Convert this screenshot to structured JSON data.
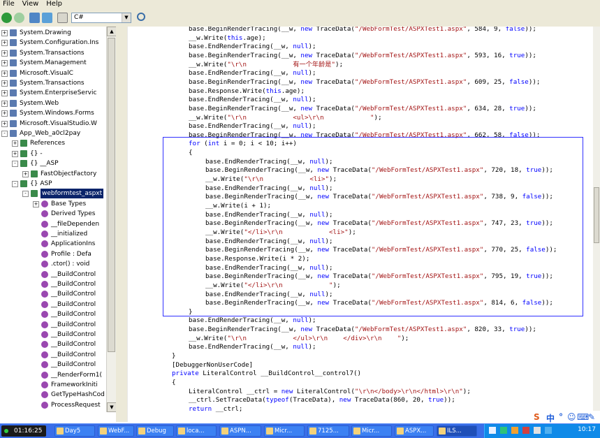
{
  "menu": [
    "File",
    "View",
    "Help"
  ],
  "toolbar": {
    "language": "C#"
  },
  "tree": {
    "items": [
      {
        "label": "System.Drawing",
        "level": 0,
        "exp": "+"
      },
      {
        "label": "System.Configuration.Ins",
        "level": 0,
        "exp": "+"
      },
      {
        "label": "System.Transactions",
        "level": 0,
        "exp": "+"
      },
      {
        "label": "System.Management",
        "level": 0,
        "exp": "+"
      },
      {
        "label": "Microsoft.VisualC",
        "level": 0,
        "exp": "+"
      },
      {
        "label": "System.Transactions",
        "level": 0,
        "exp": "+"
      },
      {
        "label": "System.EnterpriseServic",
        "level": 0,
        "exp": "+"
      },
      {
        "label": "System.Web",
        "level": 0,
        "exp": "+"
      },
      {
        "label": "System.Windows.Forms",
        "level": 0,
        "exp": "+"
      },
      {
        "label": "Microsoft.VisualStudio.W",
        "level": 0,
        "exp": "+"
      },
      {
        "label": "App_Web_a0cl2pay",
        "level": 0,
        "exp": "-"
      },
      {
        "label": "References",
        "level": 1,
        "exp": "+"
      },
      {
        "label": "{} -",
        "level": 1,
        "exp": "+"
      },
      {
        "label": "{} __ASP",
        "level": 1,
        "exp": "-"
      },
      {
        "label": "FastObjectFactory",
        "level": 2,
        "exp": "+"
      },
      {
        "label": "{} ASP",
        "level": 1,
        "exp": "-"
      },
      {
        "label": "webformtest_aspxt",
        "level": 2,
        "exp": "-",
        "selected": true
      },
      {
        "label": "Base Types",
        "level": 3,
        "exp": "+"
      },
      {
        "label": "Derived Types",
        "level": 3,
        "exp": ""
      },
      {
        "label": "__fileDependen",
        "level": 3,
        "exp": ""
      },
      {
        "label": "__initialized",
        "level": 3,
        "exp": ""
      },
      {
        "label": "ApplicationIns",
        "level": 3,
        "exp": ""
      },
      {
        "label": "Profile : Defa",
        "level": 3,
        "exp": ""
      },
      {
        "label": ".ctor() : void",
        "level": 3,
        "exp": ""
      },
      {
        "label": "__BuildControl",
        "level": 3,
        "exp": ""
      },
      {
        "label": "__BuildControl",
        "level": 3,
        "exp": ""
      },
      {
        "label": "__BuildControl",
        "level": 3,
        "exp": ""
      },
      {
        "label": "__BuildControl",
        "level": 3,
        "exp": ""
      },
      {
        "label": "__BuildControl",
        "level": 3,
        "exp": ""
      },
      {
        "label": "__BuildControl",
        "level": 3,
        "exp": ""
      },
      {
        "label": "__BuildControl",
        "level": 3,
        "exp": ""
      },
      {
        "label": "__BuildControl",
        "level": 3,
        "exp": ""
      },
      {
        "label": "__BuildControl",
        "level": 3,
        "exp": ""
      },
      {
        "label": "__BuildControl",
        "level": 3,
        "exp": ""
      },
      {
        "label": "__RenderForm1(",
        "level": 3,
        "exp": ""
      },
      {
        "label": "FrameworkIniti",
        "level": 3,
        "exp": ""
      },
      {
        "label": "GetTypeHashCod",
        "level": 3,
        "exp": ""
      },
      {
        "label": "ProcessRequest",
        "level": 3,
        "exp": ""
      }
    ]
  },
  "code": {
    "lines": [
      {
        "indent": 2,
        "parts": [
          [
            "base.BeginRenderTracing(__w, ",
            ""
          ],
          [
            "new",
            "kw"
          ],
          [
            " TraceData(",
            ""
          ],
          [
            "\"/WebFormTest/ASPXTest1.aspx\"",
            "str"
          ],
          [
            ", 584, 9, ",
            ""
          ],
          [
            "false",
            "kw"
          ],
          [
            "));",
            ""
          ]
        ]
      },
      {
        "indent": 2,
        "parts": [
          [
            "__w.Write(",
            ""
          ],
          [
            "this",
            "kw"
          ],
          [
            ".age);",
            ""
          ]
        ]
      },
      {
        "indent": 2,
        "parts": [
          [
            "base.EndRenderTracing(__w, ",
            ""
          ],
          [
            "null",
            "kw"
          ],
          [
            ");",
            ""
          ]
        ]
      },
      {
        "indent": 2,
        "parts": [
          [
            "base.BeginRenderTracing(__w, ",
            ""
          ],
          [
            "new",
            "kw"
          ],
          [
            " TraceData(",
            ""
          ],
          [
            "\"/WebFormTest/ASPXTest1.aspx\"",
            "str"
          ],
          [
            ", 593, 16, ",
            ""
          ],
          [
            "true",
            "kw"
          ],
          [
            "));",
            ""
          ]
        ]
      },
      {
        "indent": 2,
        "parts": [
          [
            "__w.Write(",
            ""
          ],
          [
            "\"\\r\\n            有一个年龄是\"",
            "str"
          ],
          [
            ");",
            ""
          ]
        ]
      },
      {
        "indent": 2,
        "parts": [
          [
            "base.EndRenderTracing(__w, ",
            ""
          ],
          [
            "null",
            "kw"
          ],
          [
            ");",
            ""
          ]
        ]
      },
      {
        "indent": 2,
        "parts": [
          [
            "base.BeginRenderTracing(__w, ",
            ""
          ],
          [
            "new",
            "kw"
          ],
          [
            " TraceData(",
            ""
          ],
          [
            "\"/WebFormTest/ASPXTest1.aspx\"",
            "str"
          ],
          [
            ", 609, 25, ",
            ""
          ],
          [
            "false",
            "kw"
          ],
          [
            "));",
            ""
          ]
        ]
      },
      {
        "indent": 2,
        "parts": [
          [
            "base.Response.Write(",
            ""
          ],
          [
            "this",
            "kw"
          ],
          [
            ".age);",
            ""
          ]
        ]
      },
      {
        "indent": 2,
        "parts": [
          [
            "base.EndRenderTracing(__w, ",
            ""
          ],
          [
            "null",
            "kw"
          ],
          [
            ");",
            ""
          ]
        ]
      },
      {
        "indent": 2,
        "parts": [
          [
            "base.BeginRenderTracing(__w, ",
            ""
          ],
          [
            "new",
            "kw"
          ],
          [
            " TraceData(",
            ""
          ],
          [
            "\"/WebFormTest/ASPXTest1.aspx\"",
            "str"
          ],
          [
            ", 634, 28, ",
            ""
          ],
          [
            "true",
            "kw"
          ],
          [
            "));",
            ""
          ]
        ]
      },
      {
        "indent": 2,
        "parts": [
          [
            "__w.Write(",
            ""
          ],
          [
            "\"\\r\\n            <ul>\\r\\n            \"",
            "str"
          ],
          [
            ");",
            ""
          ]
        ]
      },
      {
        "indent": 2,
        "parts": [
          [
            "base.EndRenderTracing(__w, ",
            ""
          ],
          [
            "null",
            "kw"
          ],
          [
            ");",
            ""
          ]
        ]
      },
      {
        "indent": 2,
        "parts": [
          [
            "base.BeginRenderTracing(__w, ",
            ""
          ],
          [
            "new",
            "kw"
          ],
          [
            " TraceData(",
            ""
          ],
          [
            "\"/WebFormTest/ASPXTest1.aspx\"",
            "str"
          ],
          [
            ", 662, 58, ",
            ""
          ],
          [
            "false",
            "kw"
          ],
          [
            "));",
            ""
          ]
        ]
      },
      {
        "indent": 2,
        "parts": [
          [
            "for",
            "kw"
          ],
          [
            " (",
            ""
          ],
          [
            "int",
            "kw"
          ],
          [
            " i = 0; i < 10; i++)",
            ""
          ]
        ]
      },
      {
        "indent": 2,
        "parts": [
          [
            "{",
            ""
          ]
        ]
      },
      {
        "indent": 3,
        "parts": [
          [
            "base.EndRenderTracing(__w, ",
            ""
          ],
          [
            "null",
            "kw"
          ],
          [
            ");",
            ""
          ]
        ]
      },
      {
        "indent": 3,
        "parts": [
          [
            "base.BeginRenderTracing(__w, ",
            ""
          ],
          [
            "new",
            "kw"
          ],
          [
            " TraceData(",
            ""
          ],
          [
            "\"/WebFormTest/ASPXTest1.aspx\"",
            "str"
          ],
          [
            ", 720, 18, ",
            ""
          ],
          [
            "true",
            "kw"
          ],
          [
            "));",
            ""
          ]
        ]
      },
      {
        "indent": 3,
        "parts": [
          [
            "__w.Write(",
            ""
          ],
          [
            "\"\\r\\n            <li>\"",
            "str"
          ],
          [
            ");",
            ""
          ]
        ]
      },
      {
        "indent": 3,
        "parts": [
          [
            "base.EndRenderTracing(__w, ",
            ""
          ],
          [
            "null",
            "kw"
          ],
          [
            ");",
            ""
          ]
        ]
      },
      {
        "indent": 3,
        "parts": [
          [
            "base.BeginRenderTracing(__w, ",
            ""
          ],
          [
            "new",
            "kw"
          ],
          [
            " TraceData(",
            ""
          ],
          [
            "\"/WebFormTest/ASPXTest1.aspx\"",
            "str"
          ],
          [
            ", 738, 9, ",
            ""
          ],
          [
            "false",
            "kw"
          ],
          [
            "));",
            ""
          ]
        ]
      },
      {
        "indent": 3,
        "parts": [
          [
            "__w.Write(i + 1);",
            ""
          ]
        ]
      },
      {
        "indent": 3,
        "parts": [
          [
            "base.EndRenderTracing(__w, ",
            ""
          ],
          [
            "null",
            "kw"
          ],
          [
            ");",
            ""
          ]
        ]
      },
      {
        "indent": 3,
        "parts": [
          [
            "base.BeginRenderTracing(__w, ",
            ""
          ],
          [
            "new",
            "kw"
          ],
          [
            " TraceData(",
            ""
          ],
          [
            "\"/WebFormTest/ASPXTest1.aspx\"",
            "str"
          ],
          [
            ", 747, 23, ",
            ""
          ],
          [
            "true",
            "kw"
          ],
          [
            "));",
            ""
          ]
        ]
      },
      {
        "indent": 3,
        "parts": [
          [
            "__w.Write(",
            ""
          ],
          [
            "\"</li>\\r\\n            <li>\"",
            "str"
          ],
          [
            ");",
            ""
          ]
        ]
      },
      {
        "indent": 3,
        "parts": [
          [
            "base.EndRenderTracing(__w, ",
            ""
          ],
          [
            "null",
            "kw"
          ],
          [
            ");",
            ""
          ]
        ]
      },
      {
        "indent": 3,
        "parts": [
          [
            "base.BeginRenderTracing(__w, ",
            ""
          ],
          [
            "new",
            "kw"
          ],
          [
            " TraceData(",
            ""
          ],
          [
            "\"/WebFormTest/ASPXTest1.aspx\"",
            "str"
          ],
          [
            ", 770, 25, ",
            ""
          ],
          [
            "false",
            "kw"
          ],
          [
            "));",
            ""
          ]
        ]
      },
      {
        "indent": 3,
        "parts": [
          [
            "base.Response.Write(i * 2);",
            ""
          ]
        ]
      },
      {
        "indent": 3,
        "parts": [
          [
            "base.EndRenderTracing(__w, ",
            ""
          ],
          [
            "null",
            "kw"
          ],
          [
            ");",
            ""
          ]
        ]
      },
      {
        "indent": 3,
        "parts": [
          [
            "base.BeginRenderTracing(__w, ",
            ""
          ],
          [
            "new",
            "kw"
          ],
          [
            " TraceData(",
            ""
          ],
          [
            "\"/WebFormTest/ASPXTest1.aspx\"",
            "str"
          ],
          [
            ", 795, 19, ",
            ""
          ],
          [
            "true",
            "kw"
          ],
          [
            "));",
            ""
          ]
        ]
      },
      {
        "indent": 3,
        "parts": [
          [
            "__w.Write(",
            ""
          ],
          [
            "\"</li>\\r\\n            \"",
            "str"
          ],
          [
            ");",
            ""
          ]
        ]
      },
      {
        "indent": 3,
        "parts": [
          [
            "base.EndRenderTracing(__w, ",
            ""
          ],
          [
            "null",
            "kw"
          ],
          [
            ");",
            ""
          ]
        ]
      },
      {
        "indent": 3,
        "parts": [
          [
            "base.BeginRenderTracing(__w, ",
            ""
          ],
          [
            "new",
            "kw"
          ],
          [
            " TraceData(",
            ""
          ],
          [
            "\"/WebFormTest/ASPXTest1.aspx\"",
            "str"
          ],
          [
            ", 814, 6, ",
            ""
          ],
          [
            "false",
            "kw"
          ],
          [
            "));",
            ""
          ]
        ]
      },
      {
        "indent": 2,
        "parts": [
          [
            "}",
            ""
          ]
        ]
      },
      {
        "indent": 2,
        "parts": [
          [
            "base.EndRenderTracing(__w, ",
            ""
          ],
          [
            "null",
            "kw"
          ],
          [
            ");",
            ""
          ]
        ]
      },
      {
        "indent": 2,
        "parts": [
          [
            "base.BeginRenderTracing(__w, ",
            ""
          ],
          [
            "new",
            "kw"
          ],
          [
            " TraceData(",
            ""
          ],
          [
            "\"/WebFormTest/ASPXTest1.aspx\"",
            "str"
          ],
          [
            ", 820, 33, ",
            ""
          ],
          [
            "true",
            "kw"
          ],
          [
            "));",
            ""
          ]
        ]
      },
      {
        "indent": 2,
        "parts": [
          [
            "__w.Write(",
            ""
          ],
          [
            "\"\\r\\n            </ul>\\r\\n    </div>\\r\\n    \"",
            "str"
          ],
          [
            ");",
            ""
          ]
        ]
      },
      {
        "indent": 2,
        "parts": [
          [
            "base.EndRenderTracing(__w, ",
            ""
          ],
          [
            "null",
            "kw"
          ],
          [
            ");",
            ""
          ]
        ]
      },
      {
        "indent": 1,
        "parts": [
          [
            "}",
            ""
          ]
        ]
      },
      {
        "indent": 1,
        "parts": [
          [
            "[DebuggerNonUserCode]",
            ""
          ]
        ]
      },
      {
        "indent": 1,
        "parts": [
          [
            "private",
            "kw"
          ],
          [
            " LiteralControl __BuildControl__control7()",
            ""
          ]
        ]
      },
      {
        "indent": 1,
        "parts": [
          [
            "{",
            ""
          ]
        ]
      },
      {
        "indent": 2,
        "parts": [
          [
            "LiteralControl __ctrl = ",
            ""
          ],
          [
            "new",
            "kw"
          ],
          [
            " LiteralControl(",
            ""
          ],
          [
            "\"\\r\\n</body>\\r\\n</html>\\r\\n\"",
            "str"
          ],
          [
            ");",
            ""
          ]
        ]
      },
      {
        "indent": 2,
        "parts": [
          [
            "__ctrl.SetTraceData(",
            ""
          ],
          [
            "typeof",
            "kw"
          ],
          [
            "(TraceData), ",
            ""
          ],
          [
            "new",
            "kw"
          ],
          [
            " TraceData(860, 20, ",
            ""
          ],
          [
            "true",
            "kw"
          ],
          [
            "));",
            ""
          ]
        ]
      },
      {
        "indent": 2,
        "parts": [
          [
            "return",
            "kw"
          ],
          [
            " __ctrl;",
            ""
          ]
        ]
      }
    ]
  },
  "ime": {
    "label": "中"
  },
  "taskbar": {
    "clock": "01:16:25",
    "tasks": [
      "Day5",
      "WebF...",
      "Debug",
      "loca...",
      "ASPN...",
      "Micr...",
      "7125...",
      "Micr...",
      "ASPX...",
      "ILS..."
    ],
    "time": "10:17"
  },
  "colors": {
    "keyword": "#0000ff",
    "string": "#a31515",
    "selection": "#0a246a",
    "taskbar": "#3a6ee8"
  }
}
